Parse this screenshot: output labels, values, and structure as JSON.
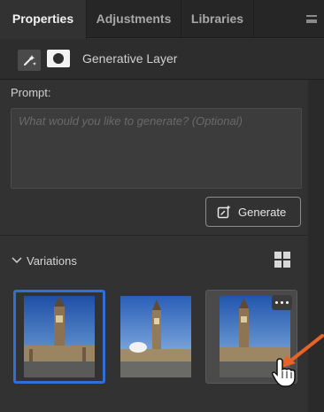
{
  "tabs": [
    {
      "label": "Properties",
      "active": true
    },
    {
      "label": "Adjustments",
      "active": false
    },
    {
      "label": "Libraries",
      "active": false
    }
  ],
  "layer": {
    "name": "Generative Layer"
  },
  "prompt": {
    "label": "Prompt:",
    "placeholder": "What would you like to generate? (Optional)",
    "value": ""
  },
  "generate_button": {
    "label": "Generate"
  },
  "variations": {
    "label": "Variations",
    "selected_index": 0,
    "count": 3
  },
  "colors": {
    "selection_accent": "#2f6fd6",
    "annotation_arrow": "#e8632a"
  },
  "icons": [
    "panel-menu-icon",
    "generative-fill-icon",
    "layer-mask-icon",
    "generate-icon",
    "chevron-down-icon",
    "grid-view-icon",
    "more-options-icon",
    "hand-cursor-icon"
  ]
}
